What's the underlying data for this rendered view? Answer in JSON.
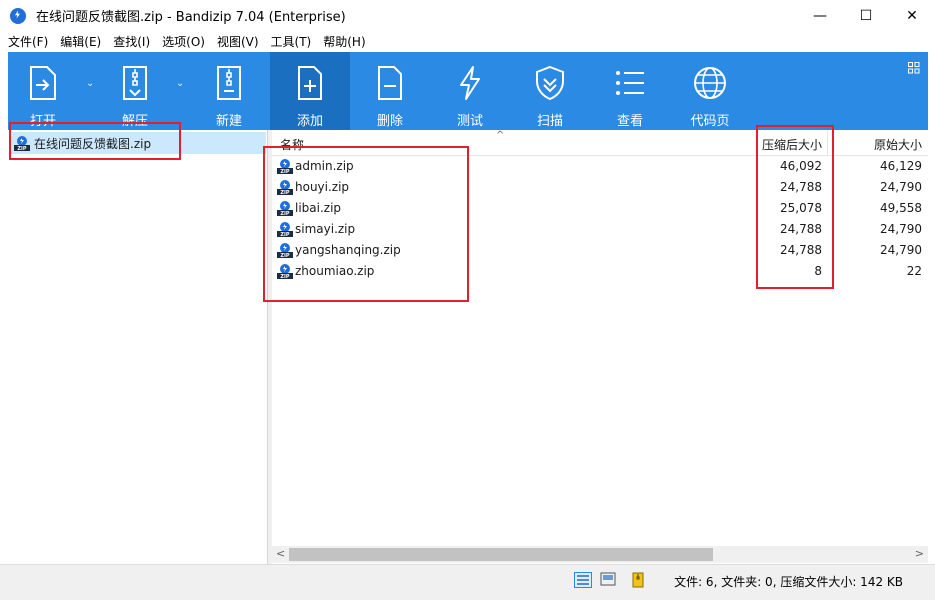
{
  "window": {
    "title": "在线问题反馈截图.zip - Bandizip 7.04 (Enterprise)",
    "controls": {
      "minimize": "—",
      "maximize": "☐",
      "close": "✕"
    }
  },
  "menu": [
    "文件(F)",
    "编辑(E)",
    "查找(I)",
    "选项(O)",
    "视图(V)",
    "工具(T)",
    "帮助(H)"
  ],
  "toolbar": {
    "open": "打开",
    "extract": "解压",
    "new": "新建",
    "add": "添加",
    "delete": "删除",
    "test": "测试",
    "scan": "扫描",
    "view": "查看",
    "codepage": "代码页"
  },
  "tree": {
    "root": "在线问题反馈截图.zip"
  },
  "columns": {
    "name": "名称",
    "packed": "压缩后大小",
    "original": "原始大小"
  },
  "files": [
    {
      "name": "admin.zip",
      "packed": "46,092",
      "original": "46,129"
    },
    {
      "name": "houyi.zip",
      "packed": "24,788",
      "original": "24,790"
    },
    {
      "name": "libai.zip",
      "packed": "25,078",
      "original": "49,558"
    },
    {
      "name": "simayi.zip",
      "packed": "24,788",
      "original": "24,790"
    },
    {
      "name": "yangshanqing.zip",
      "packed": "24,788",
      "original": "24,790"
    },
    {
      "name": "zhoumiao.zip",
      "packed": "8",
      "original": "22"
    }
  ],
  "status": {
    "text": "文件: 6, 文件夹: 0, 压缩文件大小: 142 KB"
  },
  "colors": {
    "toolbar": "#2b8ae4",
    "toolbar_active": "#1b6fc1",
    "annotation": "#e0202c",
    "selection": "#cce8ff"
  },
  "icons": {
    "app": "bandizip-icon",
    "archive": "zip-file-icon",
    "view_mode": [
      "details-view-icon",
      "preview-view-icon",
      "archive-view-icon"
    ]
  }
}
